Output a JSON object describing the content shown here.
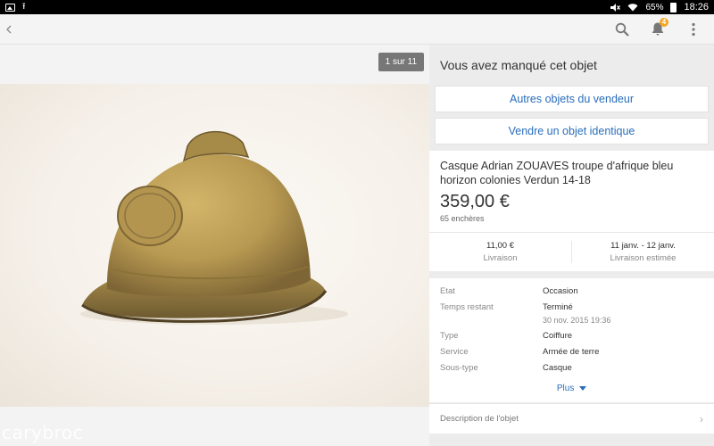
{
  "status_bar": {
    "battery": "65%",
    "time": "18:26"
  },
  "toolbar": {
    "back_icon": "chevron-left-icon",
    "notification_count": "4"
  },
  "photo": {
    "counter": "1 sur 11",
    "watermark": "carybroc"
  },
  "panel": {
    "missed_title": "Vous avez manqué cet objet",
    "seller_items_label": "Autres objets du vendeur",
    "sell_similar_label": "Vendre un objet identique",
    "item": {
      "title": "Casque Adrian ZOUAVES troupe d'afrique bleu horizon colonies Verdun 14-18",
      "price": "359,00 €",
      "bids": "65 enchères"
    },
    "shipping": {
      "cost": "11,00 €",
      "cost_label": "Livraison",
      "dates": "11 janv. - 12 janv.",
      "dates_label": "Livraison estimée"
    },
    "details": [
      {
        "key": "Etat",
        "value": "Occasion"
      },
      {
        "key": "Temps restant",
        "value": "Terminé",
        "sub": "30 nov. 2015 19:36"
      },
      {
        "key": "Type",
        "value": "Coiffure"
      },
      {
        "key": "Service",
        "value": "Armée de terre"
      },
      {
        "key": "Sous-type",
        "value": "Casque"
      }
    ],
    "more_label": "Plus",
    "description_label": "Description de l'objet"
  },
  "colors": {
    "link_blue": "#2a6ebb",
    "badge_orange": "#f5a623"
  }
}
